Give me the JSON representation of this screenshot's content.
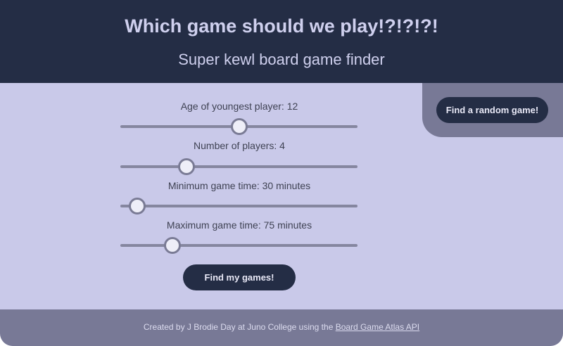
{
  "header": {
    "title": "Which game should we play!?!?!?!",
    "subtitle": "Super kewl board game finder"
  },
  "random_button": {
    "label": "Find a random game!"
  },
  "sliders": [
    {
      "label": "Age of youngest player: 12",
      "value": 12,
      "position": 0.5
    },
    {
      "label": "Number of players: 4",
      "value": 4,
      "position": 0.28
    },
    {
      "label": "Minimum game time: 30 minutes",
      "value": 30,
      "position": 0.07
    },
    {
      "label": "Maximum game time: 75 minutes",
      "value": 75,
      "position": 0.22
    }
  ],
  "find_button": {
    "label": "Find my games!"
  },
  "footer": {
    "text": "Created by J Brodie Day at Juno College using the ",
    "link_text": "Board Game Atlas API"
  },
  "colors": {
    "header_bg": "#242d45",
    "main_bg": "#c9c9e9",
    "panel_bg": "#787996",
    "button_bg": "#242d45"
  }
}
